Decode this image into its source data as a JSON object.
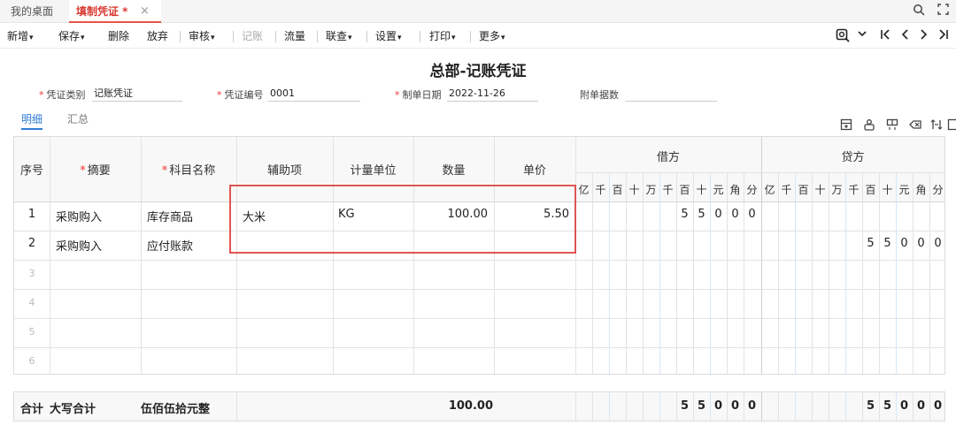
{
  "tabs": {
    "desktop": "我的桌面",
    "voucher": "填制凭证 *",
    "close_glyph": "×"
  },
  "window_icons": [
    "search-icon",
    "maximize-icon"
  ],
  "toolbar": {
    "add": "新增",
    "save": "保存",
    "delete": "删除",
    "discard": "放弃",
    "audit": "审核",
    "post": "记账",
    "flow": "流量",
    "linked": "联查",
    "settings": "设置",
    "print": "打印",
    "more": "更多",
    "caret": "▾"
  },
  "title": "总部-记账凭证",
  "header": {
    "voucher_type_label": "凭证类别",
    "voucher_type_value": "记账凭证",
    "voucher_no_label": "凭证编号",
    "voucher_no_value": "0001",
    "date_label": "制单日期",
    "date_value": "2022-11-26",
    "attachments_label": "附单据数",
    "attachments_value": "",
    "required_mark": "*"
  },
  "subtabs": {
    "detail": "明细",
    "summary": "汇总"
  },
  "columns": {
    "seq": "序号",
    "summary": "摘要",
    "account": "科目名称",
    "aux": "辅助项",
    "unit": "计量单位",
    "qty": "数量",
    "price": "单价",
    "debit": "借方",
    "credit": "贷方",
    "digits": [
      "亿",
      "千",
      "百",
      "十",
      "万",
      "千",
      "百",
      "十",
      "元",
      "角",
      "分"
    ]
  },
  "rows": [
    {
      "seq": "1",
      "summary": "采购购入",
      "account": "库存商品",
      "aux": "大米",
      "unit": "KG",
      "qty": "100.00",
      "price": "5.50",
      "debit_digits": [
        "",
        "",
        "",
        "",
        "",
        "",
        "5",
        "5",
        "0",
        "0",
        "0"
      ],
      "credit_digits": [
        "",
        "",
        "",
        "",
        "",
        "",
        "",
        "",
        "",
        "",
        ""
      ]
    },
    {
      "seq": "2",
      "summary": "采购购入",
      "account": "应付账款",
      "aux": "",
      "unit": "",
      "qty": "",
      "price": "",
      "debit_digits": [
        "",
        "",
        "",
        "",
        "",
        "",
        "",
        "",
        "",
        "",
        ""
      ],
      "credit_digits": [
        "",
        "",
        "",
        "",
        "",
        "",
        "5",
        "5",
        "0",
        "0",
        "0"
      ]
    }
  ],
  "empty_rows": [
    "3",
    "4",
    "5",
    "6"
  ],
  "totals": {
    "label": "合计",
    "uppercase_label": "大写合计",
    "uppercase_value": "伍佰伍拾元整",
    "qty": "100.00",
    "debit_digits": [
      "",
      "",
      "",
      "",
      "",
      "",
      "5",
      "5",
      "0",
      "0",
      "0"
    ],
    "credit_digits": [
      "",
      "",
      "",
      "",
      "",
      "",
      "5",
      "5",
      "0",
      "0",
      "0"
    ]
  },
  "colors": {
    "accent_red": "#e05555",
    "accent_blue": "#2f7cd6"
  }
}
